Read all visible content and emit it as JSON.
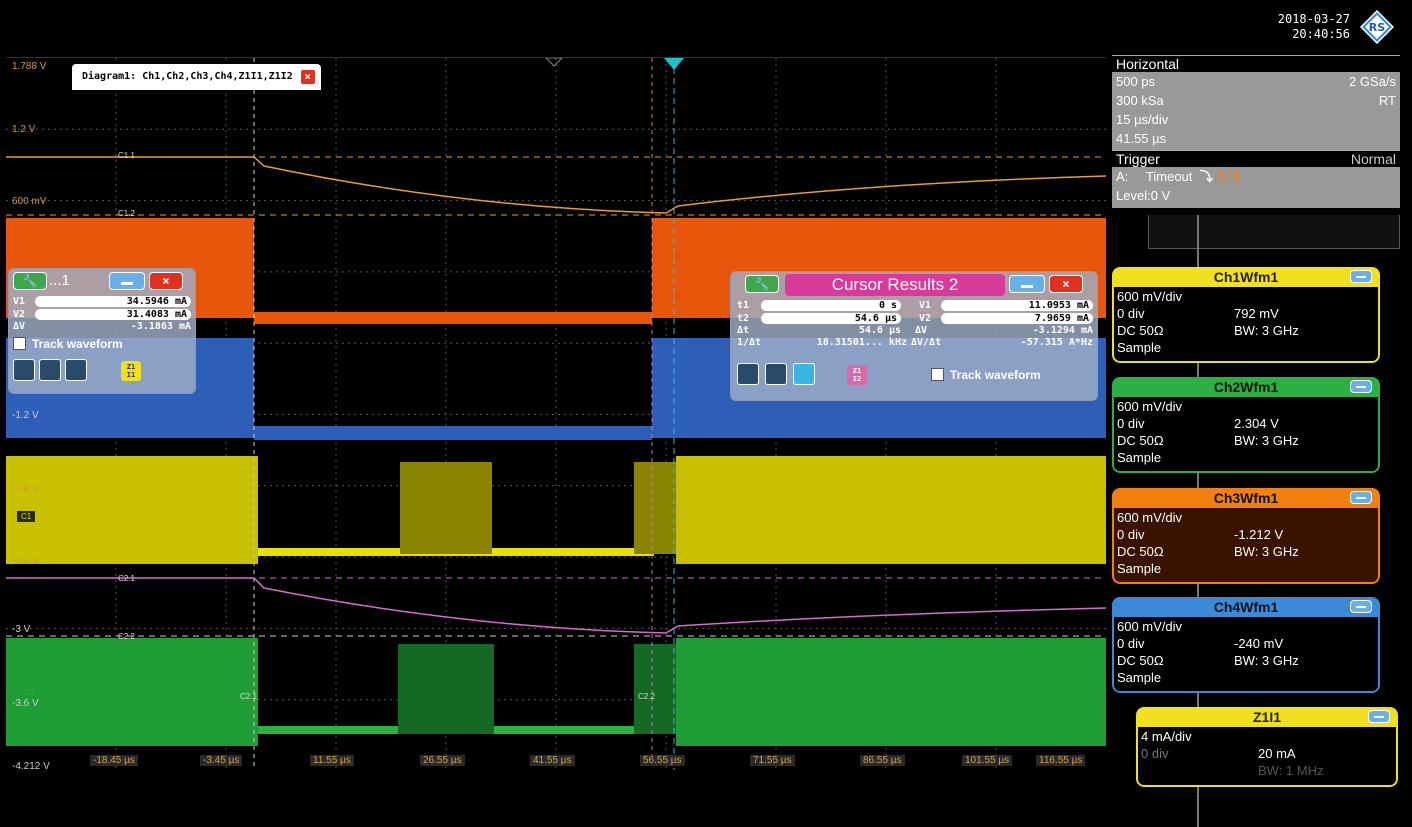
{
  "header": {
    "date": "2018-03-27",
    "time": "20:40:56",
    "logo_text": "RS"
  },
  "diagram": {
    "tab_label": "Diagram1: Ch1,Ch2,Ch3,Ch4,Z1I1,Z1I2",
    "close_icon": "close-icon"
  },
  "y_labels": [
    "1.788 V",
    "1.2 V",
    "600 mV",
    "-1.2 V",
    "-1.8 V",
    "-2.4 V",
    "-3 V",
    "-3.6 V",
    "-4.212 V"
  ],
  "x_labels": [
    "-18.45 µs",
    "-3.45 µs",
    "11.55 µs",
    "26.55 µs",
    "41.55 µs",
    "56.55 µs",
    "71.55 µs",
    "86.55 µs",
    "101.55 µs",
    "116.55 µs"
  ],
  "markers": {
    "c11": "C1.1",
    "c12": "C1.2",
    "c21": "C2.1",
    "c22": "C2.2",
    "c1": "C1",
    "c2": "C2",
    "c2_1b": "C2.1",
    "c2_2b": "C2.2"
  },
  "cursor1": {
    "title": "...1",
    "v1_label": "V1",
    "v1": "34.5946 mA",
    "v2_label": "V2",
    "v2": "31.4083 mA",
    "dv_label": "ΔV",
    "dv": "-3.1863 mA",
    "track_label": "Track waveform",
    "zicon": "Z1 I1"
  },
  "cursor2": {
    "title": "Cursor Results 2",
    "t1_label": "t1",
    "t1": "0 s",
    "t2_label": "t2",
    "t2": "54.6 µs",
    "dt_label": "Δt",
    "dt": "54.6 µs",
    "inv_dt_label": "1/Δt",
    "inv_dt": "18.31501... kHz",
    "v1_label": "V1",
    "v1": "11.0953 mA",
    "v2_label": "V2",
    "v2": "7.9659 mA",
    "dv_label": "ΔV",
    "dv": "-3.1294 mA",
    "dvdt_label": "ΔV/Δt",
    "dvdt": "-57.315 A*Hz",
    "track_label": "Track waveform",
    "zicon": "Z1 I2"
  },
  "horizontal": {
    "title": "Horizontal",
    "resolution": "500 ps",
    "sample_rate": "2 GSa/s",
    "record_length": "300 kSa",
    "mode": "RT",
    "scale": "15 µs/div",
    "position": "41.55 µs"
  },
  "trigger": {
    "title": "Trigger",
    "mode": "Normal",
    "source_prefix": "A:",
    "type": "Timeout",
    "source": "Ch3",
    "level": "Level:0 V"
  },
  "waveforms": [
    {
      "name": "Ch1Wfm1",
      "scale": "600 mV/div",
      "offset": "0 div",
      "value": "792 mV",
      "coupling": "DC 50Ω",
      "bw": "BW: 3 GHz",
      "acq": "Sample",
      "color": "#f0e020"
    },
    {
      "name": "Ch2Wfm1",
      "scale": "600 mV/div",
      "offset": "0 div",
      "value": "2.304 V",
      "coupling": "DC 50Ω",
      "bw": "BW: 3 GHz",
      "acq": "Sample",
      "color": "#2db042"
    },
    {
      "name": "Ch3Wfm1",
      "scale": "600 mV/div",
      "offset": "0 div",
      "value": "-1.212 V",
      "coupling": "DC 50Ω",
      "bw": "BW: 3 GHz",
      "acq": "Sample",
      "color": "#f08010"
    },
    {
      "name": "Ch4Wfm1",
      "scale": "600 mV/div",
      "offset": "0 div",
      "value": "-240 mV",
      "coupling": "DC 50Ω",
      "bw": "BW: 3 GHz",
      "acq": "Sample",
      "color": "#3a8ad8"
    },
    {
      "name": "Z1I1",
      "scale": "4 mA/div",
      "offset": "0 div",
      "value": "20 mA",
      "bw": "BW: 1 MHz",
      "color": "#f0e020"
    }
  ]
}
